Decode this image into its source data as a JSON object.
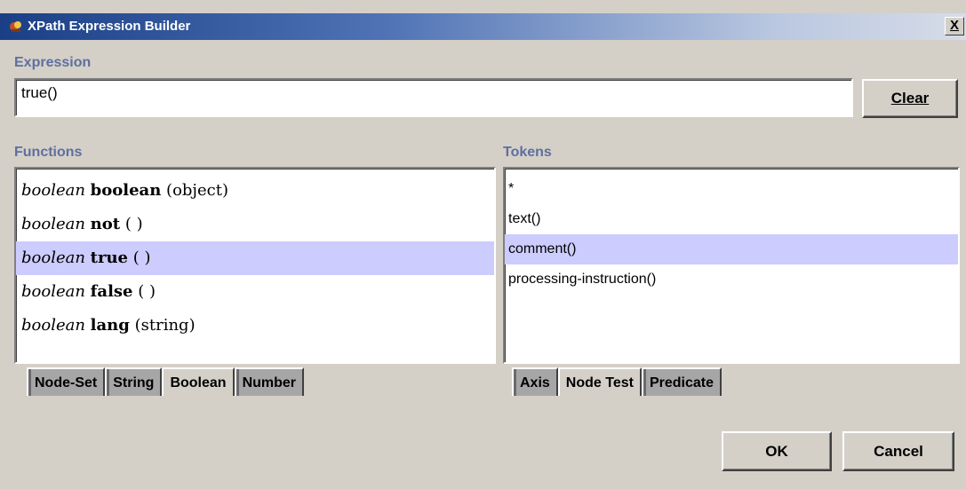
{
  "window": {
    "title": "XPath Expression Builder",
    "close_label": "X"
  },
  "expression": {
    "label": "Expression",
    "value": "true()",
    "clear_label": "Clear"
  },
  "functions": {
    "label": "Functions",
    "items": [
      {
        "type": "boolean",
        "name": "boolean",
        "args": "(object)",
        "selected": false
      },
      {
        "type": "boolean",
        "name": "not",
        "args": "( )",
        "selected": false
      },
      {
        "type": "boolean",
        "name": "true",
        "args": "( )",
        "selected": true
      },
      {
        "type": "boolean",
        "name": "false",
        "args": "( )",
        "selected": false
      },
      {
        "type": "boolean",
        "name": "lang",
        "args": "(string)",
        "selected": false
      }
    ],
    "tabs": [
      "Node-Set",
      "String",
      "Boolean",
      "Number"
    ],
    "active_tab": "Boolean"
  },
  "tokens": {
    "label": "Tokens",
    "items": [
      "*",
      "text()",
      "comment()",
      "processing-instruction()"
    ],
    "selected_index": 2,
    "tabs": [
      "Axis",
      "Node Test",
      "Predicate"
    ],
    "active_tab": "Node Test"
  },
  "footer": {
    "ok_label": "OK",
    "cancel_label": "Cancel"
  },
  "colors": {
    "selection": "#ccccff",
    "section_label": "#5f6f9f",
    "titlebar_start": "#1a3f86"
  }
}
